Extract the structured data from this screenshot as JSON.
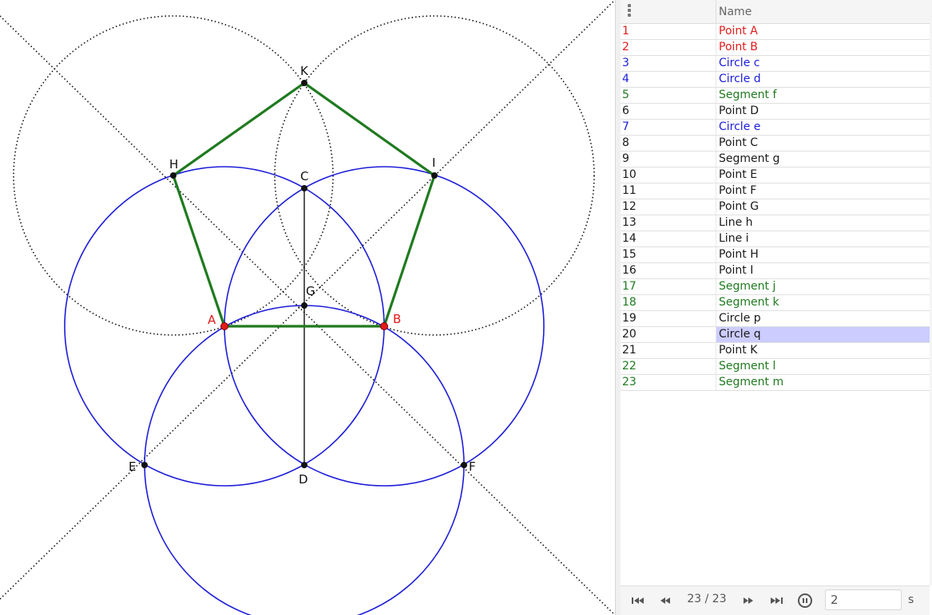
{
  "colors": {
    "red": "#e21b1b",
    "blue": "#1d1dd8",
    "green": "#1f7a1f",
    "black": "#1a1a1a",
    "selection": "#ccccff"
  },
  "graphics": {
    "labels": {
      "K": "K",
      "H": "H",
      "I": "I",
      "C": "C",
      "G": "G",
      "A": "A",
      "B": "B",
      "E": "E",
      "D": "D",
      "F": "F"
    }
  },
  "protocol": {
    "menu_icon": "vertical-dots-icon",
    "header_name": "Name",
    "rows": [
      {
        "num": "1",
        "name": "Point A",
        "color": "red"
      },
      {
        "num": "2",
        "name": "Point B",
        "color": "red"
      },
      {
        "num": "3",
        "name": "Circle c",
        "color": "blue"
      },
      {
        "num": "4",
        "name": "Circle d",
        "color": "blue"
      },
      {
        "num": "5",
        "name": "Segment f",
        "color": "green"
      },
      {
        "num": "6",
        "name": "Point D",
        "color": "black"
      },
      {
        "num": "7",
        "name": "Circle e",
        "color": "blue"
      },
      {
        "num": "8",
        "name": "Point C",
        "color": "black"
      },
      {
        "num": "9",
        "name": "Segment g",
        "color": "black"
      },
      {
        "num": "10",
        "name": "Point E",
        "color": "black"
      },
      {
        "num": "11",
        "name": "Point F",
        "color": "black"
      },
      {
        "num": "12",
        "name": "Point G",
        "color": "black"
      },
      {
        "num": "13",
        "name": "Line h",
        "color": "black"
      },
      {
        "num": "14",
        "name": "Line i",
        "color": "black"
      },
      {
        "num": "15",
        "name": "Point H",
        "color": "black"
      },
      {
        "num": "16",
        "name": "Point I",
        "color": "black"
      },
      {
        "num": "17",
        "name": "Segment j",
        "color": "green"
      },
      {
        "num": "18",
        "name": "Segment k",
        "color": "green"
      },
      {
        "num": "19",
        "name": "Circle p",
        "color": "black"
      },
      {
        "num": "20",
        "name": "Circle q",
        "color": "black",
        "selected": true
      },
      {
        "num": "21",
        "name": "Point K",
        "color": "black"
      },
      {
        "num": "22",
        "name": "Segment l",
        "color": "green"
      },
      {
        "num": "23",
        "name": "Segment m",
        "color": "green"
      }
    ],
    "footer": {
      "step_counter": "23 / 23",
      "speed_value": "2",
      "speed_unit": "s",
      "icons": [
        "skip-first-icon",
        "step-back-icon",
        "step-forward-icon",
        "skip-last-icon",
        "pause-icon"
      ]
    }
  }
}
